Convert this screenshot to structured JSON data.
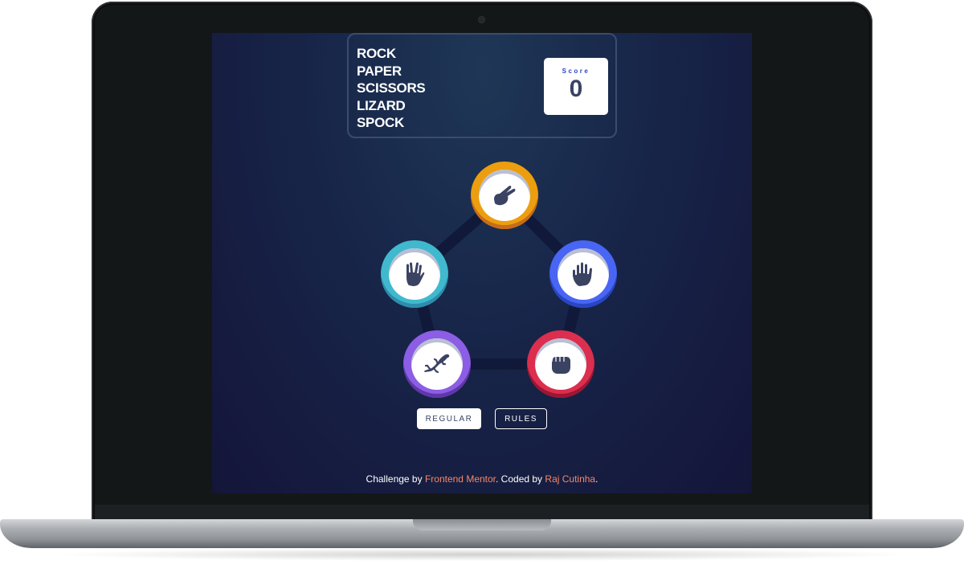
{
  "app": {
    "title_lines": [
      "ROCK",
      "PAPER",
      "SCISSORS",
      "LIZARD",
      "SPOCK"
    ],
    "score": {
      "label": "Score",
      "value": "0"
    }
  },
  "tokens": [
    {
      "id": "scissors",
      "icon": "scissors-hand-icon",
      "color": "#ec9e0e"
    },
    {
      "id": "paper",
      "icon": "paper-hand-icon",
      "color": "#4865f4"
    },
    {
      "id": "rock",
      "icon": "rock-fist-icon",
      "color": "#dc2e4e"
    },
    {
      "id": "lizard",
      "icon": "lizard-icon",
      "color": "#8c5de5"
    },
    {
      "id": "spock",
      "icon": "spock-hand-icon",
      "color": "#40b9ce"
    }
  ],
  "buttons": {
    "mode": "REGULAR",
    "rules": "RULES"
  },
  "footer": {
    "prefix": "Challenge by",
    "link1": "Frontend Mentor",
    "middle": ". Coded by",
    "link2": "Raj Cutinha",
    "suffix": "."
  },
  "colors": {
    "background_top": "#1f3756",
    "background_bottom": "#141539",
    "header_outline": "#3a4c6e",
    "score_text": "#3b4363",
    "footer_link": "#f4876a"
  }
}
